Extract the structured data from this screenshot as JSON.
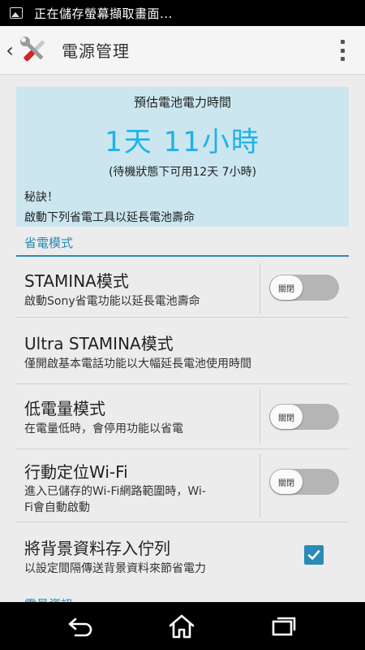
{
  "status_bar": {
    "icon": "image-icon",
    "text": "正在儲存螢幕擷取畫面..."
  },
  "action_bar": {
    "back_icon": "chevron-left-icon",
    "app_icon": "tools-icon",
    "title": "電源管理",
    "menu_icon": "overflow-menu-icon"
  },
  "battery": {
    "label": "預估電池電力時間",
    "time": "1天 11小時",
    "standby": "(待機狀態下可用12天 7小時)",
    "tip_title": "秘訣！",
    "tip_body": "啟動下列省電工具以延長電池壽命",
    "accent_color": "#1fb2ea",
    "card_color": "#cbe6ef"
  },
  "section": {
    "title": "省電模式",
    "peek_text": "電量資訊"
  },
  "settings": [
    {
      "title": "STAMINA模式",
      "subtitle": "啟動Sony省電功能以延長電池壽命",
      "control": "toggle",
      "state": "關閉"
    },
    {
      "title": "Ultra STAMINA模式",
      "subtitle": "僅開啟基本電話功能以大幅延長電池使用時間",
      "control": "none"
    },
    {
      "title": "低電量模式",
      "subtitle": "在電量低時，會停用功能以省電",
      "control": "toggle",
      "state": "關閉"
    },
    {
      "title": "行動定位Wi-Fi",
      "subtitle_line1": "進入已儲存的Wi-Fi網路範圍時，Wi-",
      "subtitle_line2": "Fi會自動啟動",
      "control": "toggle",
      "state": "關閉"
    },
    {
      "title": "將背景資料存入佇列",
      "subtitle": "以設定間隔傳送背景資料來節省電力",
      "control": "checkbox",
      "checked": true
    }
  ],
  "nav_bar": {
    "back": "back-icon",
    "home": "home-icon",
    "recents": "recents-icon"
  },
  "colors": {
    "section_accent": "#2a8ab8",
    "toggle_off": "#b5b5b5"
  }
}
